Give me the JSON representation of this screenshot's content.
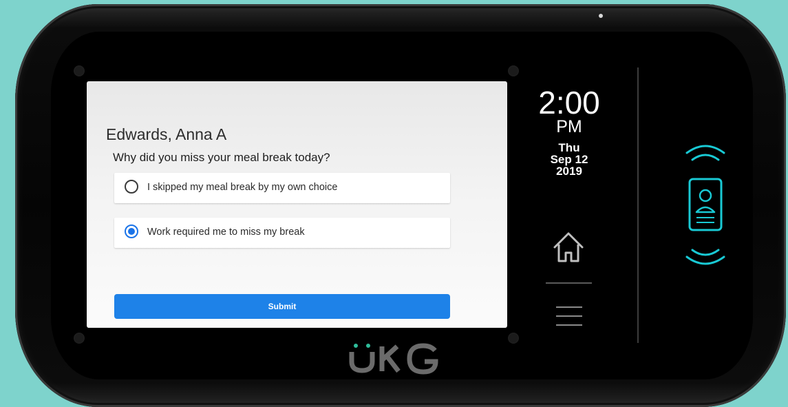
{
  "device": {
    "brand": "UKG"
  },
  "screen": {
    "employee_name": "Edwards, Anna A",
    "question": "Why did you miss your meal break today?",
    "options": [
      {
        "label": "I skipped my meal break by my own choice",
        "selected": false
      },
      {
        "label": "Work required me to miss my break",
        "selected": true
      }
    ],
    "submit_label": "Submit"
  },
  "clock": {
    "time": "2:00",
    "ampm": "PM",
    "day": "Thu",
    "date": "Sep 12",
    "year": "2019"
  },
  "icons": {
    "home": "home-icon",
    "menu": "hamburger-menu-icon",
    "badge": "badge-reader-icon"
  },
  "colors": {
    "accent": "#1e82e8",
    "reader": "#19c9d4",
    "background": "#7ed3cc"
  }
}
